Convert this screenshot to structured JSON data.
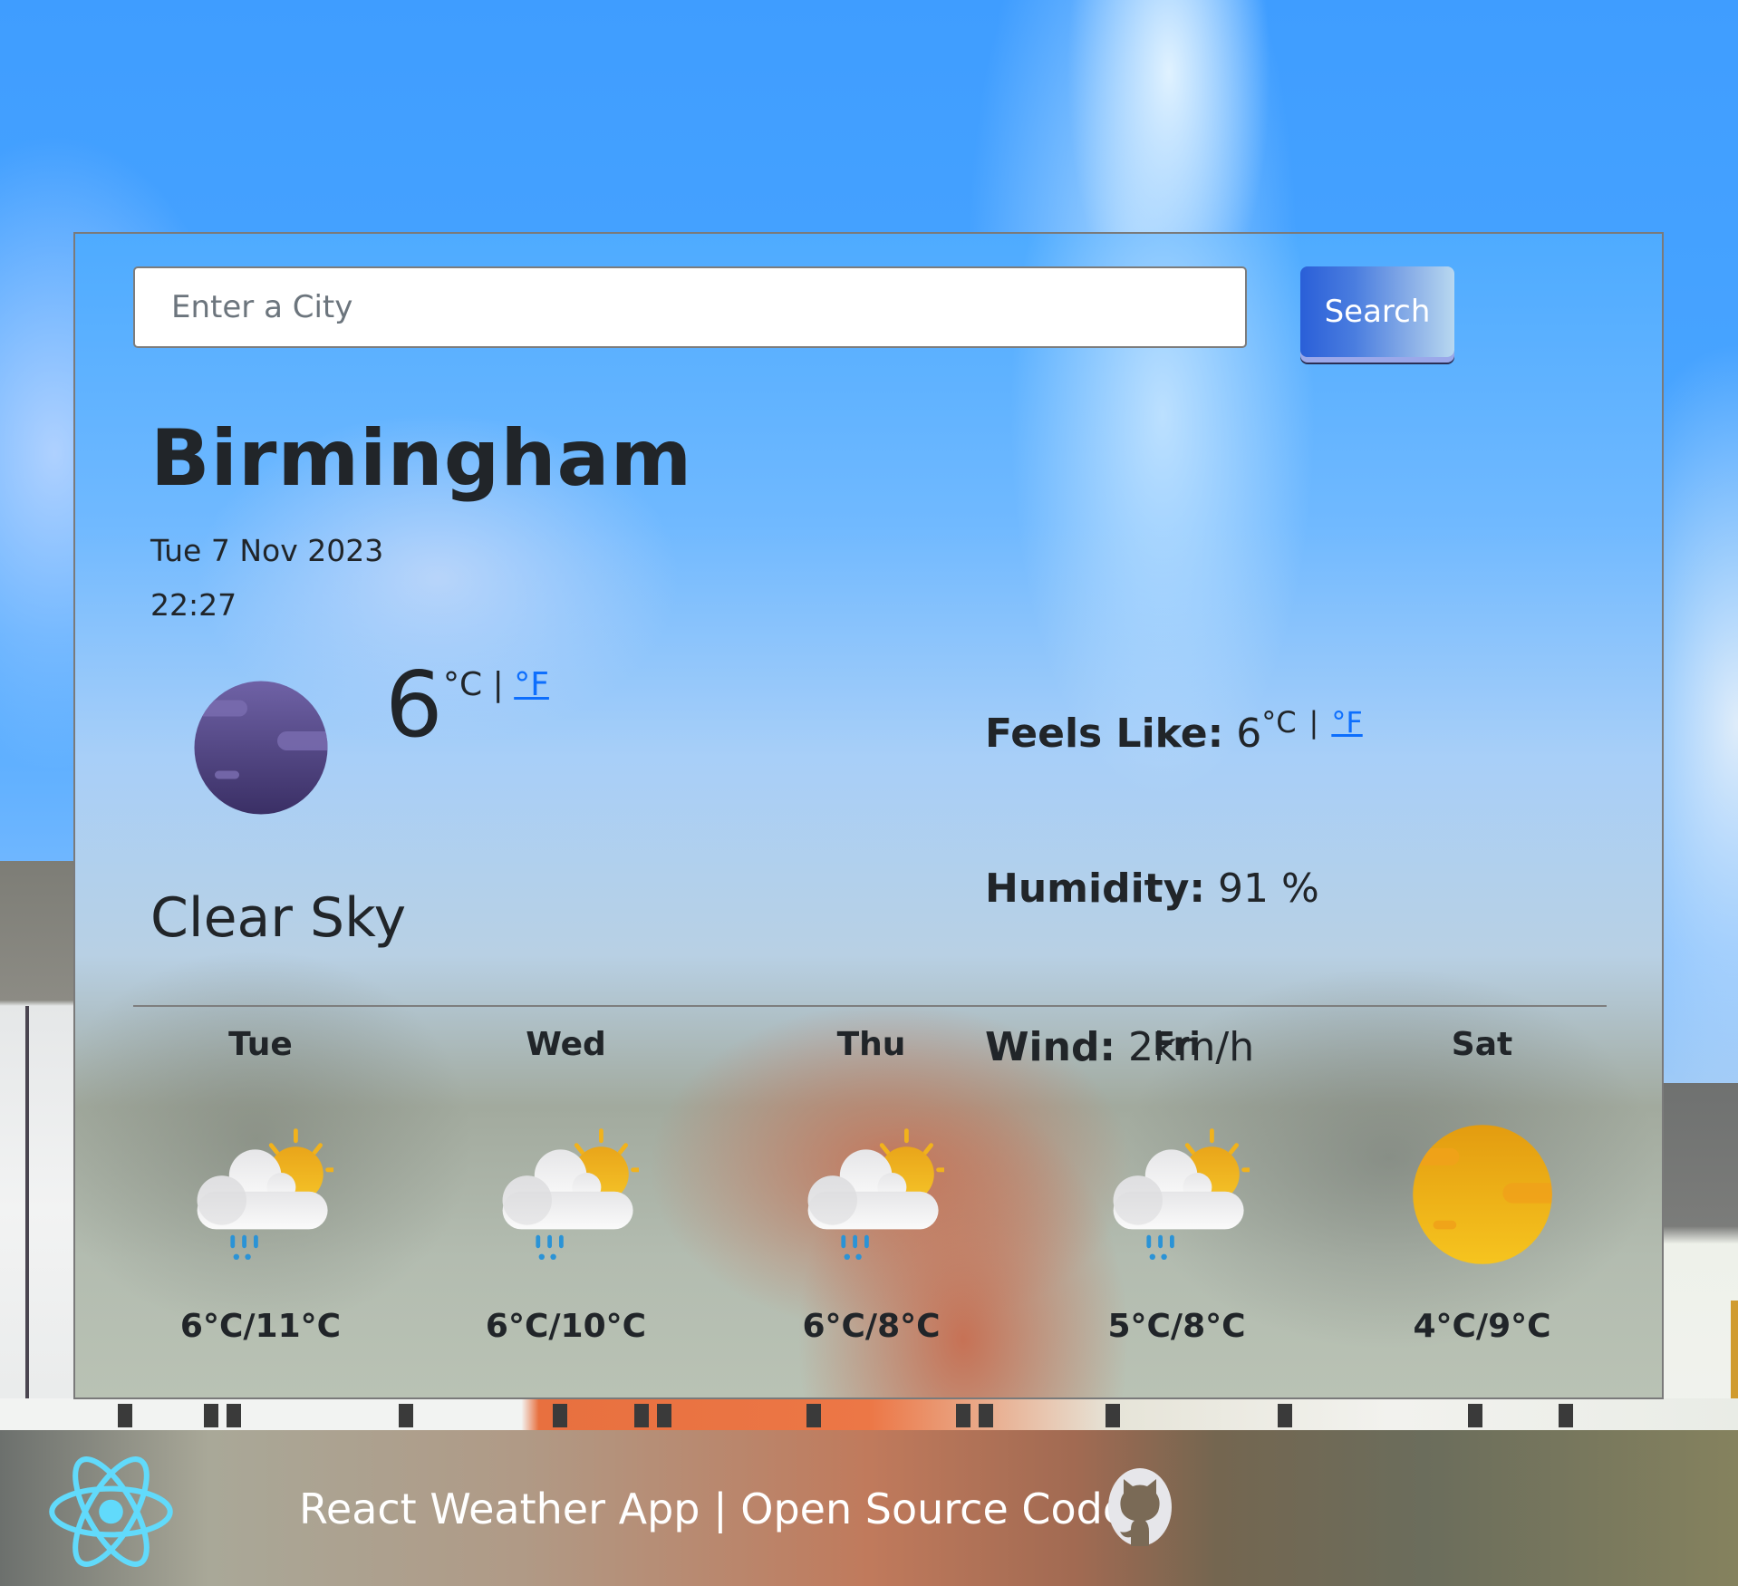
{
  "search": {
    "placeholder": "Enter a City",
    "value": "",
    "button_label": "Search"
  },
  "current": {
    "city": "Birmingham",
    "date": "Tue 7 Nov 2023",
    "time": "22:27",
    "icon": "clear-night-moon-icon",
    "temperature": "6",
    "unit_celsius": "°C",
    "unit_separator": "|",
    "unit_fahrenheit": "°F",
    "description": "Clear Sky"
  },
  "stats": {
    "feels_like_label": "Feels Like:",
    "feels_like_value": "6",
    "feels_like_unit_c": "°C",
    "feels_like_separator": "|",
    "feels_like_unit_f": "°F",
    "humidity_label": "Humidity:",
    "humidity_value": "91 %",
    "wind_label": "Wind:",
    "wind_value": "2km/h"
  },
  "forecast": [
    {
      "day": "Tue",
      "icon": "partly-cloudy-rain-icon",
      "temps": "6°C/11°C"
    },
    {
      "day": "Wed",
      "icon": "partly-cloudy-rain-icon",
      "temps": "6°C/10°C"
    },
    {
      "day": "Thu",
      "icon": "partly-cloudy-rain-icon",
      "temps": "6°C/8°C"
    },
    {
      "day": "Fri",
      "icon": "partly-cloudy-rain-icon",
      "temps": "5°C/8°C"
    },
    {
      "day": "Sat",
      "icon": "clear-sun-icon",
      "temps": "4°C/9°C"
    }
  ],
  "footer": {
    "app_name": "React Weather App",
    "separator": "|",
    "source_link": "Open Source Code",
    "logo_icon": "react-logo-icon",
    "repo_icon": "github-icon"
  },
  "colors": {
    "link": "#0d6efd",
    "text": "#212529",
    "button_gradient_start": "#2a5fd8",
    "button_gradient_end": "#b8d8f0",
    "react_cyan": "#61dafb"
  }
}
